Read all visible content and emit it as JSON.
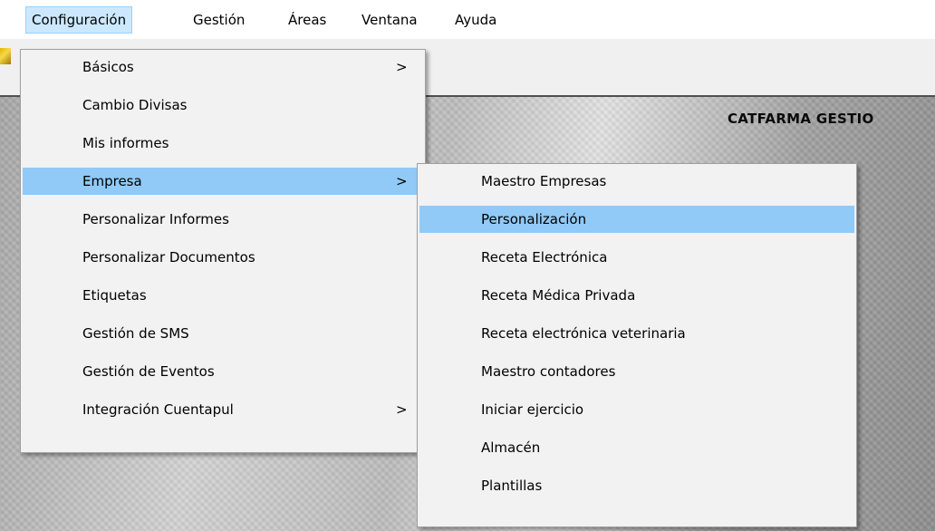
{
  "menubar": {
    "items": [
      "Configuración",
      "Gestión",
      "Áreas",
      "Ventana",
      "Ayuda"
    ]
  },
  "app": {
    "title": "CATFARMA GESTIO"
  },
  "menu_config": {
    "items": [
      {
        "label": "Básicos",
        "arrow": ">"
      },
      {
        "label": "Cambio Divisas",
        "arrow": ""
      },
      {
        "label": "Mis informes",
        "arrow": ""
      },
      {
        "label": "Empresa",
        "arrow": ">"
      },
      {
        "label": "Personalizar Informes",
        "arrow": ""
      },
      {
        "label": "Personalizar Documentos",
        "arrow": ""
      },
      {
        "label": "Etiquetas",
        "arrow": ""
      },
      {
        "label": "Gestión de SMS",
        "arrow": ""
      },
      {
        "label": "Gestión de Eventos",
        "arrow": ""
      },
      {
        "label": "Integración Cuentapul",
        "arrow": ">"
      }
    ]
  },
  "menu_empresa": {
    "items": [
      "Maestro Empresas",
      "Personalización",
      "Receta Electrónica",
      "Receta Médica Privada",
      "Receta electrónica veterinaria",
      "Maestro contadores",
      "Iniciar ejercicio",
      "Almacén",
      "Plantillas"
    ]
  },
  "colors": {
    "highlight": "#91c9f7",
    "menubar_active": "#cce8ff"
  }
}
